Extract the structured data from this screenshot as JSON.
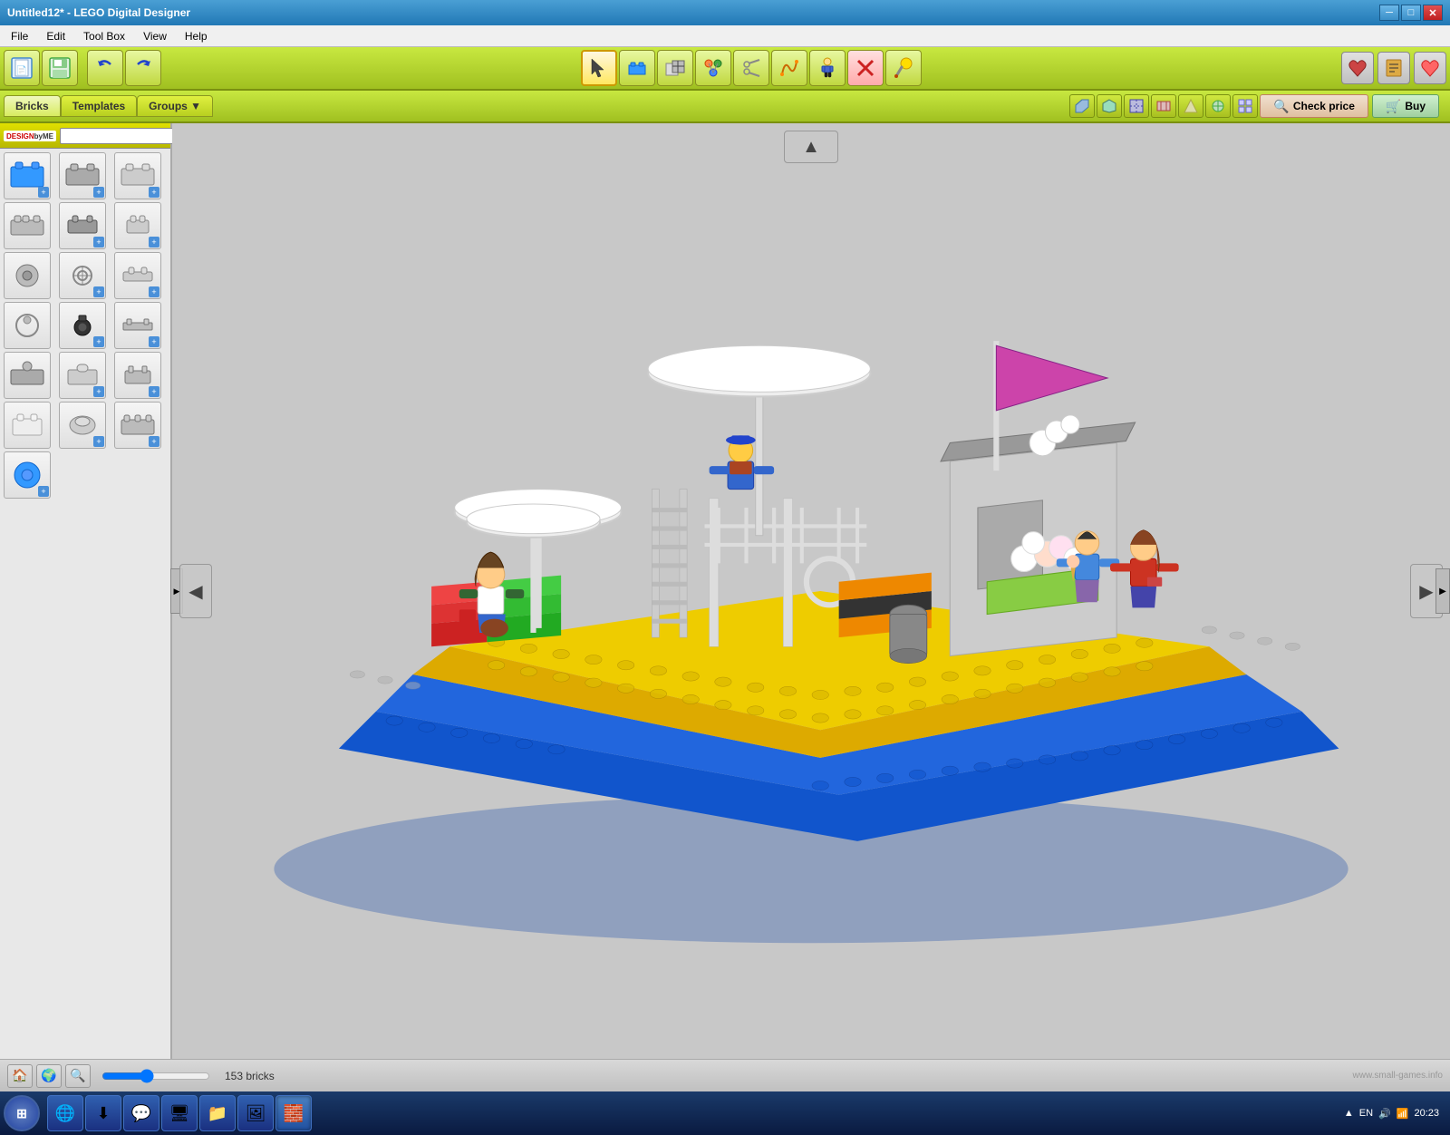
{
  "window": {
    "title": "Untitled12* - LEGO Digital Designer",
    "min_btn": "─",
    "max_btn": "□",
    "close_btn": "✕"
  },
  "menu": {
    "items": [
      "File",
      "Edit",
      "Tool Box",
      "View",
      "Help"
    ]
  },
  "toolbar": {
    "left_buttons": [
      {
        "icon": "🏠",
        "name": "new",
        "label": "New"
      },
      {
        "icon": "💾",
        "name": "save",
        "label": "Save"
      },
      {
        "icon": "↩",
        "name": "undo",
        "label": "Undo"
      },
      {
        "icon": "↪",
        "name": "redo",
        "label": "Redo"
      }
    ],
    "center_buttons": [
      {
        "icon": "↖",
        "name": "select",
        "label": "Select"
      },
      {
        "icon": "🧱",
        "name": "brick-tool",
        "label": "Brick Tool"
      },
      {
        "icon": "⊞",
        "name": "clone",
        "label": "Clone"
      },
      {
        "icon": "⊕",
        "name": "group",
        "label": "Group"
      },
      {
        "icon": "✂",
        "name": "scissors",
        "label": "Cut"
      },
      {
        "icon": "🔧",
        "name": "hinge",
        "label": "Hinge"
      },
      {
        "icon": "😊",
        "name": "minifig",
        "label": "Minifig"
      },
      {
        "icon": "✕",
        "name": "delete",
        "label": "Delete"
      },
      {
        "icon": "🎨",
        "name": "paint",
        "label": "Paint"
      }
    ],
    "right_buttons": [
      {
        "icon": "🔖",
        "name": "wishlist",
        "label": "Wishlist"
      },
      {
        "icon": "📦",
        "name": "buildingguide",
        "label": "Building Guide"
      },
      {
        "icon": "❤",
        "name": "favorite",
        "label": "Favorite"
      }
    ]
  },
  "secondary_toolbar": {
    "tabs": [
      {
        "label": "Bricks",
        "icon": "🧱",
        "active": true
      },
      {
        "label": "Templates",
        "icon": "📋",
        "active": false
      },
      {
        "label": "Groups",
        "icon": "▼",
        "active": false
      }
    ],
    "view_buttons": [
      {
        "icon": "↙",
        "name": "view1"
      },
      {
        "icon": "↗",
        "name": "view2"
      },
      {
        "icon": "←",
        "name": "view3"
      },
      {
        "icon": "→",
        "name": "view4"
      },
      {
        "icon": "↙",
        "name": "view5"
      },
      {
        "icon": "▶",
        "name": "view6"
      },
      {
        "icon": "⊡",
        "name": "view7"
      }
    ],
    "check_price_label": "Check price",
    "buy_label": "Buy"
  },
  "left_panel": {
    "logo_text": "DESIGNbyME",
    "search_placeholder": "",
    "bricks": [
      {
        "icon": "🔵",
        "has_plus": true
      },
      {
        "icon": "⬜",
        "has_plus": true
      },
      {
        "icon": "⬛",
        "has_plus": true
      },
      {
        "icon": "🔲",
        "has_plus": false
      },
      {
        "icon": "▪",
        "has_plus": true
      },
      {
        "icon": "◼",
        "has_plus": true
      },
      {
        "icon": "⬡",
        "has_plus": false
      },
      {
        "icon": "⚙",
        "has_plus": true
      },
      {
        "icon": "▬",
        "has_plus": true
      },
      {
        "icon": "🔘",
        "has_plus": false
      },
      {
        "icon": "⚫",
        "has_plus": true
      },
      {
        "icon": "▬",
        "has_plus": true
      },
      {
        "icon": "◻",
        "has_plus": false
      },
      {
        "icon": "⊙",
        "has_plus": true
      },
      {
        "icon": "▭",
        "has_plus": true
      },
      {
        "icon": "⬤",
        "has_plus": false
      },
      {
        "icon": "⬛",
        "has_plus": true
      },
      {
        "icon": "▬",
        "has_plus": true
      },
      {
        "icon": "🔵",
        "has_plus": true
      },
      {
        "icon": "⬜",
        "has_plus": false
      },
      {
        "icon": "▩",
        "has_plus": true
      }
    ]
  },
  "viewport": {
    "up_arrow": "▲",
    "left_arrow": "◀",
    "right_arrow": "▶"
  },
  "status_bar": {
    "brick_count": "153 bricks",
    "icons": [
      "🏠",
      "🌍",
      "🔍"
    ],
    "lang": "EN",
    "time": "20:23",
    "watermark": "www.small-games.info"
  },
  "taskbar": {
    "apps": [
      {
        "icon": "⊞",
        "name": "start",
        "active": false
      },
      {
        "icon": "🌐",
        "name": "chrome",
        "active": false
      },
      {
        "icon": "🔄",
        "name": "utorrent",
        "active": false
      },
      {
        "icon": "💬",
        "name": "skype",
        "active": false
      },
      {
        "icon": "🖥",
        "name": "windows-explorer",
        "active": false
      },
      {
        "icon": "📁",
        "name": "explorer",
        "active": false
      },
      {
        "icon": "🖼",
        "name": "pictures",
        "active": false
      },
      {
        "icon": "🧱",
        "name": "lego",
        "active": true
      }
    ],
    "sys_icons": [
      "▲",
      "🔊",
      "📶"
    ],
    "time": "20:23"
  }
}
